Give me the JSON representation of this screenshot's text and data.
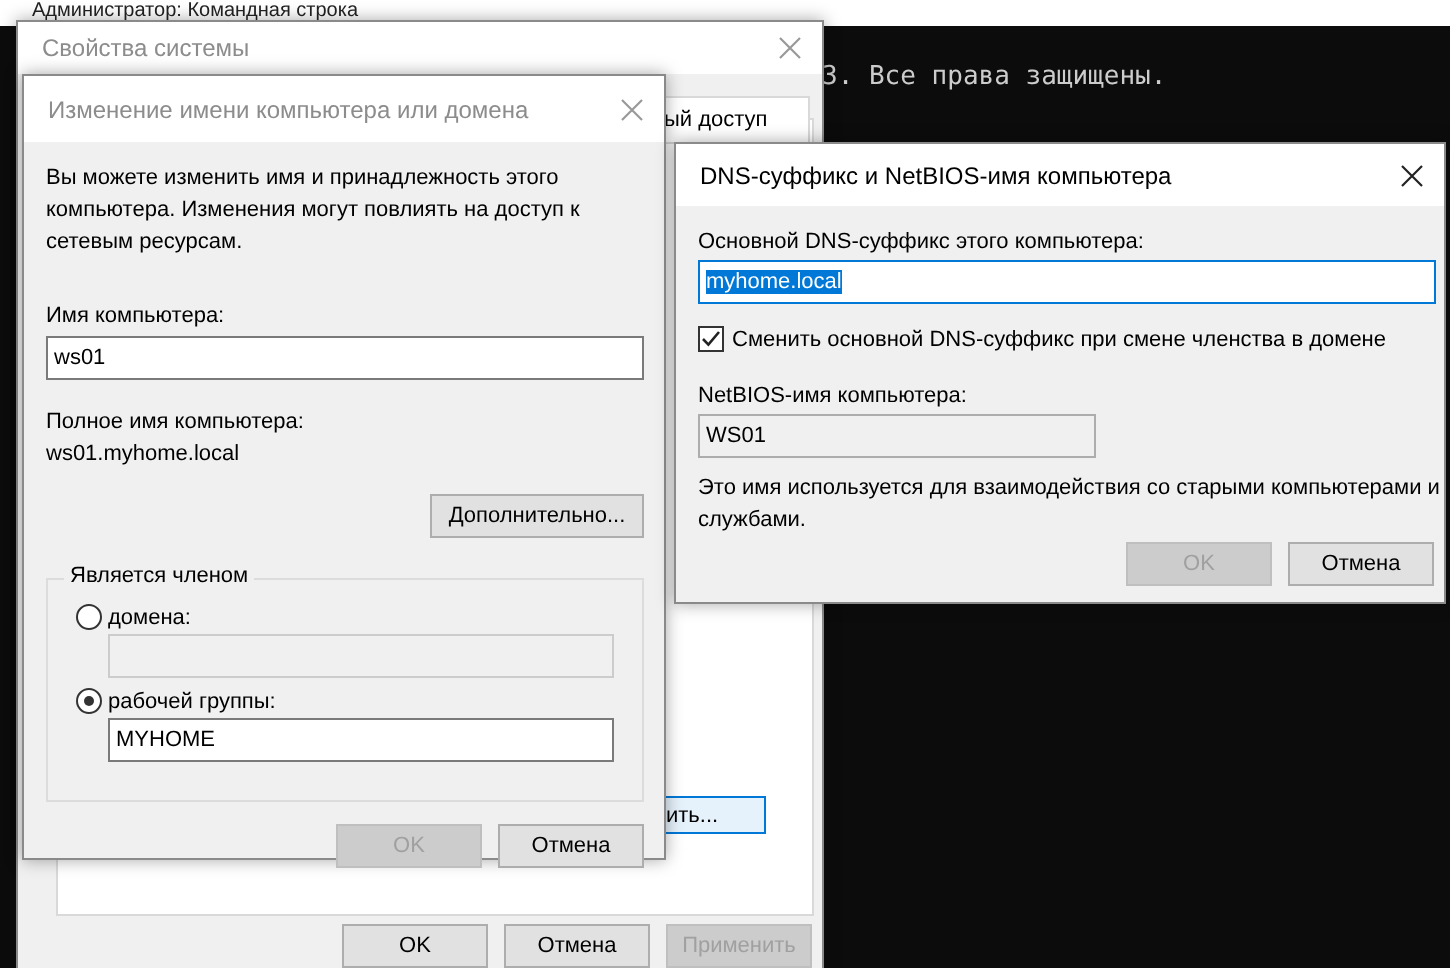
{
  "console": {
    "title": "Администратор: Командная строка",
    "lines": [
      "3. Все права защищены."
    ]
  },
  "system_properties": {
    "title": "Свойства системы",
    "tab_fragment": "ый доступ",
    "button_fragment": "ить...",
    "buttons": [
      {
        "label": "OK",
        "disabled": false
      },
      {
        "label": "Отмена",
        "disabled": false
      },
      {
        "label": "Применить",
        "disabled": true
      }
    ]
  },
  "rename_dialog": {
    "title": "Изменение имени компьютера или домена",
    "active": false,
    "description": "Вы можете изменить имя и принадлежность этого компьютера. Изменения могут повлиять на доступ к сетевым ресурсам.",
    "computer_name_label": "Имя компьютера:",
    "computer_name": "ws01",
    "full_name_label": "Полное имя компьютера:",
    "full_name": "ws01.myhome.local",
    "more_button": "Дополнительно...",
    "member_of": {
      "legend": "Является членом",
      "options": [
        {
          "label": "домена:",
          "selected": false,
          "field_disabled": true
        },
        {
          "label": "рабочей группы:",
          "selected": true,
          "field_disabled": false,
          "value": "MYHOME"
        }
      ]
    },
    "buttons": [
      {
        "label": "OK",
        "disabled": true
      },
      {
        "label": "Отмена",
        "disabled": false
      }
    ]
  },
  "dns_dialog": {
    "title": "DNS-суффикс и NetBIOS-имя компьютера",
    "active": true,
    "suffix_label": "Основной DNS-суффикс этого компьютера:",
    "suffix": "myhome.local",
    "suffix_selected": true,
    "change_on_membership": {
      "label": "Сменить основной DNS-суффикс при смене членства в домене",
      "checked": true
    },
    "netbios_label": "NetBIOS-имя компьютера:",
    "netbios_name": "WS01",
    "note": "Это имя используется для взаимодействия со старыми компьютерами и службами.",
    "buttons": [
      {
        "label": "OK",
        "disabled": true
      },
      {
        "label": "Отмена",
        "disabled": false
      }
    ]
  }
}
